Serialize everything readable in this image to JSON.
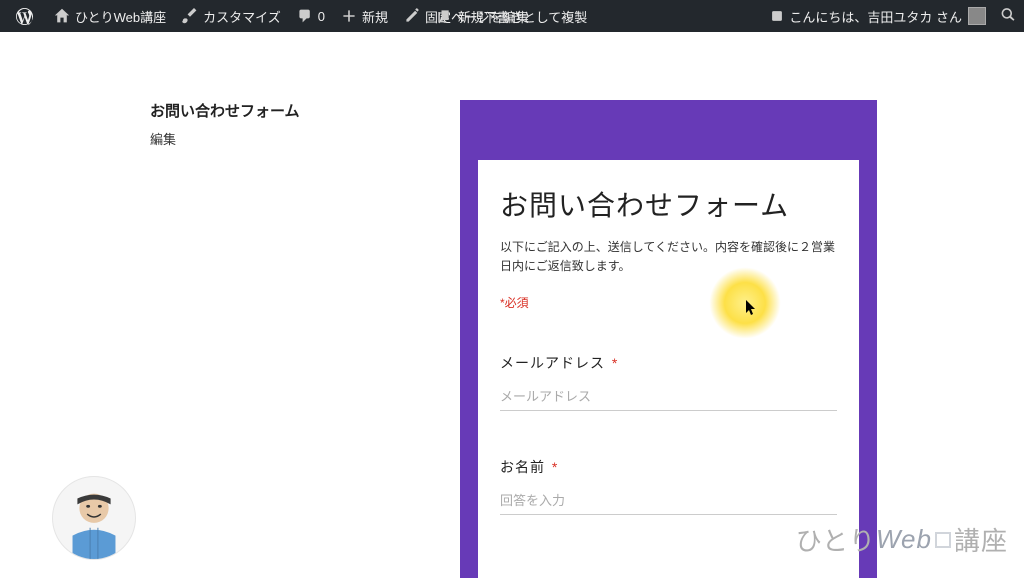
{
  "adminbar": {
    "site_title": "ひとりWeb講座",
    "customize": "カスタマイズ",
    "comments": "0",
    "new": "新規",
    "edit_page": "固定ページを編集",
    "duplicate": "新規下書きとして複製",
    "greeting": "こんにちは、吉田ユタカ さん"
  },
  "sidebar": {
    "title": "お問い合わせフォーム",
    "edit": "編集"
  },
  "form": {
    "title": "お問い合わせフォーム",
    "description": "以下にご記入の上、送信してください。内容を確認後に２営業日内にご返信致します。",
    "required_note": "*必須",
    "email_label": "メールアドレス",
    "email_placeholder": "メールアドレス",
    "name_label": "お名前",
    "name_placeholder": "回答を入力",
    "asterisk": "*"
  },
  "watermark": {
    "part1": "ひとり",
    "part2": "Web",
    "part3": "講座"
  }
}
